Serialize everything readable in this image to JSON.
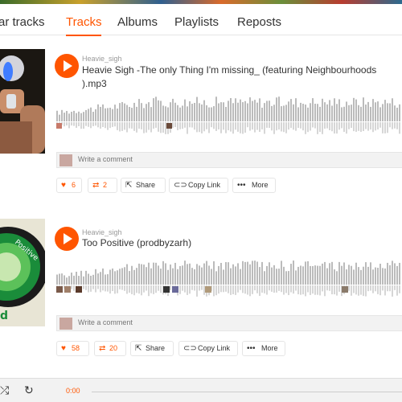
{
  "tabs": [
    {
      "label": "ar tracks"
    },
    {
      "label": "Tracks",
      "active": true
    },
    {
      "label": "Albums"
    },
    {
      "label": "Playlists"
    },
    {
      "label": "Reposts"
    }
  ],
  "tracks": [
    {
      "uploader": "Heavie_sigh",
      "title": "Heavie Sigh -The only Thing I'm missing_ (featuring Neighbourhoods ).mp3",
      "comment_placeholder": "Write a comment",
      "likes": "6",
      "reposts": "2",
      "share_label": "Share",
      "copy_link_label": "Copy Link",
      "more_label": "More"
    },
    {
      "uploader": "Heavie_sigh",
      "title": "Too Positive (prodbyzarh)",
      "comment_placeholder": "Write a comment",
      "likes": "58",
      "reposts": "20",
      "share_label": "Share",
      "copy_link_label": "Copy Link",
      "more_label": "More"
    }
  ],
  "player": {
    "time": "0:00",
    "progress": 0
  },
  "colors": {
    "accent": "#ff5500",
    "waveform": "#bbbbbb"
  },
  "icons": {
    "like": "heart-icon",
    "repost": "repost-icon",
    "share": "share-icon",
    "copy_link": "link-icon",
    "more": "more-icon",
    "shuffle": "shuffle-icon",
    "repeat": "repeat-icon",
    "play": "play-icon"
  }
}
